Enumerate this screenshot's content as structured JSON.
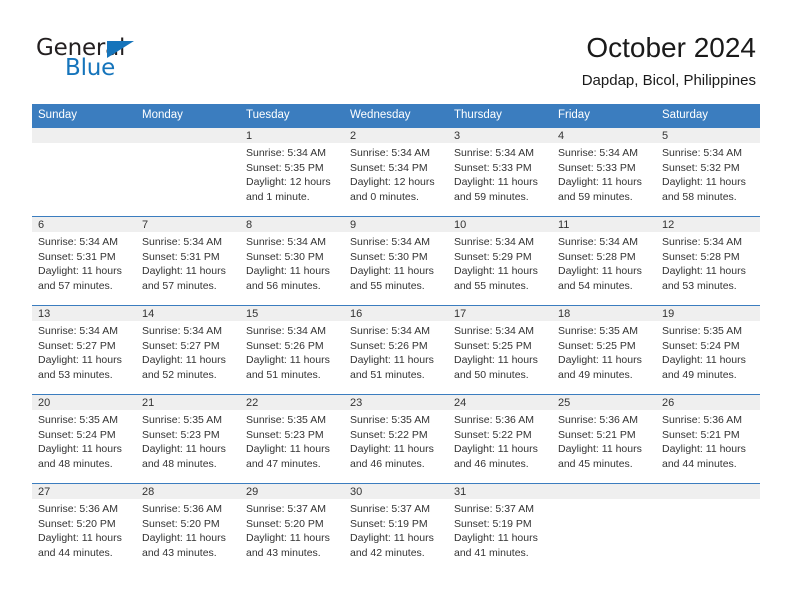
{
  "brand": {
    "name_part1": "General",
    "name_part2": "Blue",
    "accent_color": "#1574bb"
  },
  "header": {
    "title": "October 2024",
    "subtitle": "Dapdap, Bicol, Philippines"
  },
  "calendar": {
    "header_bg": "#3b7dbf",
    "daynum_bg": "#efefef",
    "weekday_headers": [
      "Sunday",
      "Monday",
      "Tuesday",
      "Wednesday",
      "Thursday",
      "Friday",
      "Saturday"
    ],
    "weeks": [
      [
        {
          "day": "",
          "sunrise": "",
          "sunset": "",
          "daylight": "",
          "daylight2": ""
        },
        {
          "day": "",
          "sunrise": "",
          "sunset": "",
          "daylight": "",
          "daylight2": ""
        },
        {
          "day": "1",
          "sunrise": "Sunrise: 5:34 AM",
          "sunset": "Sunset: 5:35 PM",
          "daylight": "Daylight: 12 hours",
          "daylight2": "and 1 minute."
        },
        {
          "day": "2",
          "sunrise": "Sunrise: 5:34 AM",
          "sunset": "Sunset: 5:34 PM",
          "daylight": "Daylight: 12 hours",
          "daylight2": "and 0 minutes."
        },
        {
          "day": "3",
          "sunrise": "Sunrise: 5:34 AM",
          "sunset": "Sunset: 5:33 PM",
          "daylight": "Daylight: 11 hours",
          "daylight2": "and 59 minutes."
        },
        {
          "day": "4",
          "sunrise": "Sunrise: 5:34 AM",
          "sunset": "Sunset: 5:33 PM",
          "daylight": "Daylight: 11 hours",
          "daylight2": "and 59 minutes."
        },
        {
          "day": "5",
          "sunrise": "Sunrise: 5:34 AM",
          "sunset": "Sunset: 5:32 PM",
          "daylight": "Daylight: 11 hours",
          "daylight2": "and 58 minutes."
        }
      ],
      [
        {
          "day": "6",
          "sunrise": "Sunrise: 5:34 AM",
          "sunset": "Sunset: 5:31 PM",
          "daylight": "Daylight: 11 hours",
          "daylight2": "and 57 minutes."
        },
        {
          "day": "7",
          "sunrise": "Sunrise: 5:34 AM",
          "sunset": "Sunset: 5:31 PM",
          "daylight": "Daylight: 11 hours",
          "daylight2": "and 57 minutes."
        },
        {
          "day": "8",
          "sunrise": "Sunrise: 5:34 AM",
          "sunset": "Sunset: 5:30 PM",
          "daylight": "Daylight: 11 hours",
          "daylight2": "and 56 minutes."
        },
        {
          "day": "9",
          "sunrise": "Sunrise: 5:34 AM",
          "sunset": "Sunset: 5:30 PM",
          "daylight": "Daylight: 11 hours",
          "daylight2": "and 55 minutes."
        },
        {
          "day": "10",
          "sunrise": "Sunrise: 5:34 AM",
          "sunset": "Sunset: 5:29 PM",
          "daylight": "Daylight: 11 hours",
          "daylight2": "and 55 minutes."
        },
        {
          "day": "11",
          "sunrise": "Sunrise: 5:34 AM",
          "sunset": "Sunset: 5:28 PM",
          "daylight": "Daylight: 11 hours",
          "daylight2": "and 54 minutes."
        },
        {
          "day": "12",
          "sunrise": "Sunrise: 5:34 AM",
          "sunset": "Sunset: 5:28 PM",
          "daylight": "Daylight: 11 hours",
          "daylight2": "and 53 minutes."
        }
      ],
      [
        {
          "day": "13",
          "sunrise": "Sunrise: 5:34 AM",
          "sunset": "Sunset: 5:27 PM",
          "daylight": "Daylight: 11 hours",
          "daylight2": "and 53 minutes."
        },
        {
          "day": "14",
          "sunrise": "Sunrise: 5:34 AM",
          "sunset": "Sunset: 5:27 PM",
          "daylight": "Daylight: 11 hours",
          "daylight2": "and 52 minutes."
        },
        {
          "day": "15",
          "sunrise": "Sunrise: 5:34 AM",
          "sunset": "Sunset: 5:26 PM",
          "daylight": "Daylight: 11 hours",
          "daylight2": "and 51 minutes."
        },
        {
          "day": "16",
          "sunrise": "Sunrise: 5:34 AM",
          "sunset": "Sunset: 5:26 PM",
          "daylight": "Daylight: 11 hours",
          "daylight2": "and 51 minutes."
        },
        {
          "day": "17",
          "sunrise": "Sunrise: 5:34 AM",
          "sunset": "Sunset: 5:25 PM",
          "daylight": "Daylight: 11 hours",
          "daylight2": "and 50 minutes."
        },
        {
          "day": "18",
          "sunrise": "Sunrise: 5:35 AM",
          "sunset": "Sunset: 5:25 PM",
          "daylight": "Daylight: 11 hours",
          "daylight2": "and 49 minutes."
        },
        {
          "day": "19",
          "sunrise": "Sunrise: 5:35 AM",
          "sunset": "Sunset: 5:24 PM",
          "daylight": "Daylight: 11 hours",
          "daylight2": "and 49 minutes."
        }
      ],
      [
        {
          "day": "20",
          "sunrise": "Sunrise: 5:35 AM",
          "sunset": "Sunset: 5:24 PM",
          "daylight": "Daylight: 11 hours",
          "daylight2": "and 48 minutes."
        },
        {
          "day": "21",
          "sunrise": "Sunrise: 5:35 AM",
          "sunset": "Sunset: 5:23 PM",
          "daylight": "Daylight: 11 hours",
          "daylight2": "and 48 minutes."
        },
        {
          "day": "22",
          "sunrise": "Sunrise: 5:35 AM",
          "sunset": "Sunset: 5:23 PM",
          "daylight": "Daylight: 11 hours",
          "daylight2": "and 47 minutes."
        },
        {
          "day": "23",
          "sunrise": "Sunrise: 5:35 AM",
          "sunset": "Sunset: 5:22 PM",
          "daylight": "Daylight: 11 hours",
          "daylight2": "and 46 minutes."
        },
        {
          "day": "24",
          "sunrise": "Sunrise: 5:36 AM",
          "sunset": "Sunset: 5:22 PM",
          "daylight": "Daylight: 11 hours",
          "daylight2": "and 46 minutes."
        },
        {
          "day": "25",
          "sunrise": "Sunrise: 5:36 AM",
          "sunset": "Sunset: 5:21 PM",
          "daylight": "Daylight: 11 hours",
          "daylight2": "and 45 minutes."
        },
        {
          "day": "26",
          "sunrise": "Sunrise: 5:36 AM",
          "sunset": "Sunset: 5:21 PM",
          "daylight": "Daylight: 11 hours",
          "daylight2": "and 44 minutes."
        }
      ],
      [
        {
          "day": "27",
          "sunrise": "Sunrise: 5:36 AM",
          "sunset": "Sunset: 5:20 PM",
          "daylight": "Daylight: 11 hours",
          "daylight2": "and 44 minutes."
        },
        {
          "day": "28",
          "sunrise": "Sunrise: 5:36 AM",
          "sunset": "Sunset: 5:20 PM",
          "daylight": "Daylight: 11 hours",
          "daylight2": "and 43 minutes."
        },
        {
          "day": "29",
          "sunrise": "Sunrise: 5:37 AM",
          "sunset": "Sunset: 5:20 PM",
          "daylight": "Daylight: 11 hours",
          "daylight2": "and 43 minutes."
        },
        {
          "day": "30",
          "sunrise": "Sunrise: 5:37 AM",
          "sunset": "Sunset: 5:19 PM",
          "daylight": "Daylight: 11 hours",
          "daylight2": "and 42 minutes."
        },
        {
          "day": "31",
          "sunrise": "Sunrise: 5:37 AM",
          "sunset": "Sunset: 5:19 PM",
          "daylight": "Daylight: 11 hours",
          "daylight2": "and 41 minutes."
        },
        {
          "day": "",
          "sunrise": "",
          "sunset": "",
          "daylight": "",
          "daylight2": ""
        },
        {
          "day": "",
          "sunrise": "",
          "sunset": "",
          "daylight": "",
          "daylight2": ""
        }
      ]
    ]
  }
}
